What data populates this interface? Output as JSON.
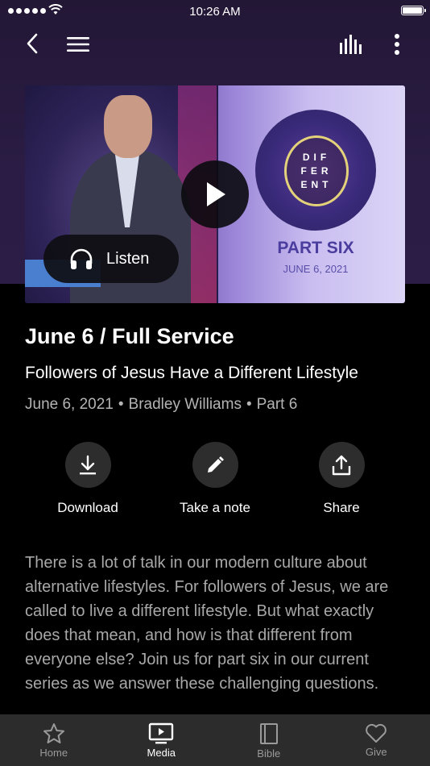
{
  "status_bar": {
    "time": "10:26 AM"
  },
  "nav": {
    "back_icon": "chevron-left-icon",
    "menu_icon": "hamburger-menu-icon",
    "audio_icon": "equalizer-icon",
    "more_icon": "vertical-dots-icon"
  },
  "hero": {
    "art_words": [
      "DIF",
      "FER",
      "ENT"
    ],
    "part_title": "PART SIX",
    "part_date": "JUNE 6, 2021",
    "play_icon": "play-icon",
    "listen_label": "Listen",
    "listen_icon": "headphones-icon"
  },
  "sermon": {
    "title": "June 6 / Full Service",
    "subtitle": "Followers of Jesus Have a Different Lifestyle",
    "date": "June 6, 2021",
    "speaker": "Bradley Williams",
    "part": "Part 6"
  },
  "actions": [
    {
      "label": "Download",
      "icon": "download-icon"
    },
    {
      "label": "Take a note",
      "icon": "pencil-icon"
    },
    {
      "label": "Share",
      "icon": "share-icon"
    }
  ],
  "description": "There is a lot of talk in our modern culture about alternative lifestyles. For followers of Jesus, we are called to live a different lifestyle. But what exactly does that mean, and how is that different from everyone else? Join us for part six in our current series as we answer these challenging questions.",
  "tabs": [
    {
      "label": "Home",
      "icon": "star-icon",
      "active": false
    },
    {
      "label": "Media",
      "icon": "tv-play-icon",
      "active": true
    },
    {
      "label": "Bible",
      "icon": "book-icon",
      "active": false
    },
    {
      "label": "Give",
      "icon": "heart-icon",
      "active": false
    }
  ],
  "colors": {
    "background": "#000000",
    "header_purple": "#2a1c44",
    "tabbar": "#2c2c2c",
    "secondary_text": "#b4b4b4"
  }
}
